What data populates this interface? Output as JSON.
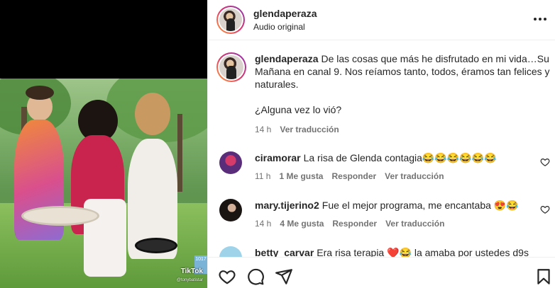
{
  "video": {
    "watermark_brand": "TikTok",
    "watermark_handle": "@tonybatistar",
    "side_badge": "1017"
  },
  "header": {
    "username": "glendaperaza",
    "subtitle": "Audio original",
    "more_icon": "more-horizontal-icon"
  },
  "caption": {
    "username": "glendaperaza",
    "text_line1": "De las cosas que más he disfrutado en mi vida…Su Mañana en canal 9. Nos reíamos tanto, todos, éramos tan felices y naturales.",
    "text_line2": "¿Alguna vez lo vió?",
    "time": "14 h",
    "translate": "Ver traducción"
  },
  "comments": [
    {
      "username": "ciramorar",
      "text": "La risa de Glenda contagia😂😂😂😂😂😂",
      "time": "11 h",
      "likes": "1 Me gusta",
      "reply": "Responder",
      "translate": "Ver traducción"
    },
    {
      "username": "mary.tijerino2",
      "text": "Fue el mejor programa, me encantaba 😍😂",
      "time": "14 h",
      "likes": "4 Me gusta",
      "reply": "Responder",
      "translate": "Ver traducción"
    },
    {
      "username": "betty_carvar",
      "text": "Era risa terapia ❤️😂 la amaba por ustedes d9s"
    }
  ],
  "actions": {
    "like_icon": "heart-icon",
    "comment_icon": "comment-icon",
    "share_icon": "share-icon",
    "save_icon": "bookmark-icon"
  }
}
